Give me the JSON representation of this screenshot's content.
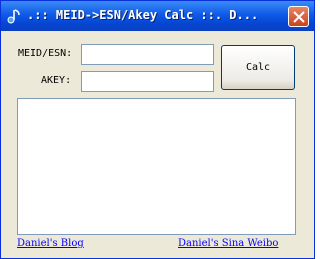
{
  "window": {
    "title": ".:: MEID->ESN/Akey Calc ::. D...",
    "close_icon": "close-icon",
    "app_icon": "app-music-note-icon"
  },
  "form": {
    "meid_label": "MEID/ESN:",
    "meid_value": "",
    "akey_label": "AKEY:",
    "akey_value": "",
    "calc_label": "Calc",
    "output_value": ""
  },
  "links": {
    "blog": "Daniel's Blog",
    "weibo": "Daniel's Sina Weibo"
  },
  "colors": {
    "titlebar": "#0549D6",
    "window_bg": "#ECE9D8",
    "close_button": "#D8532E",
    "link": "#0000FF"
  }
}
